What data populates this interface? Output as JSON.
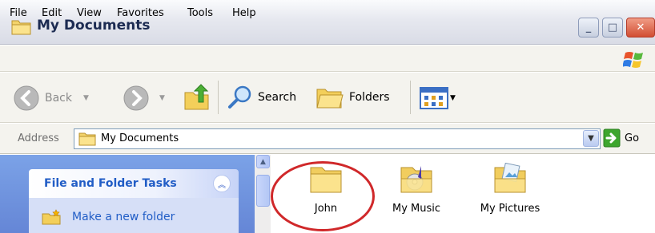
{
  "window": {
    "title": "My Documents",
    "icon": "folder-icon",
    "controls": [
      "minimize-icon",
      "maximize-icon",
      "close-icon"
    ]
  },
  "menu": {
    "items": [
      "File",
      "Edit",
      "View",
      "Favorites",
      "Tools",
      "Help"
    ]
  },
  "toolbar": {
    "back_label": "Back",
    "search_label": "Search",
    "folders_label": "Folders"
  },
  "address": {
    "label": "Address",
    "value": "My Documents",
    "go_label": "Go"
  },
  "tasks": {
    "title": "File and Folder Tasks",
    "items": [
      "Make a new folder"
    ]
  },
  "files": [
    {
      "name": "John",
      "icon": "folder-icon"
    },
    {
      "name": "My Music",
      "icon": "music-folder-icon"
    },
    {
      "name": "My Pictures",
      "icon": "pictures-folder-icon"
    }
  ],
  "colors": {
    "highlight": "#d0282a",
    "task_link": "#215dc6",
    "task_pane": "#7ba2e7"
  }
}
